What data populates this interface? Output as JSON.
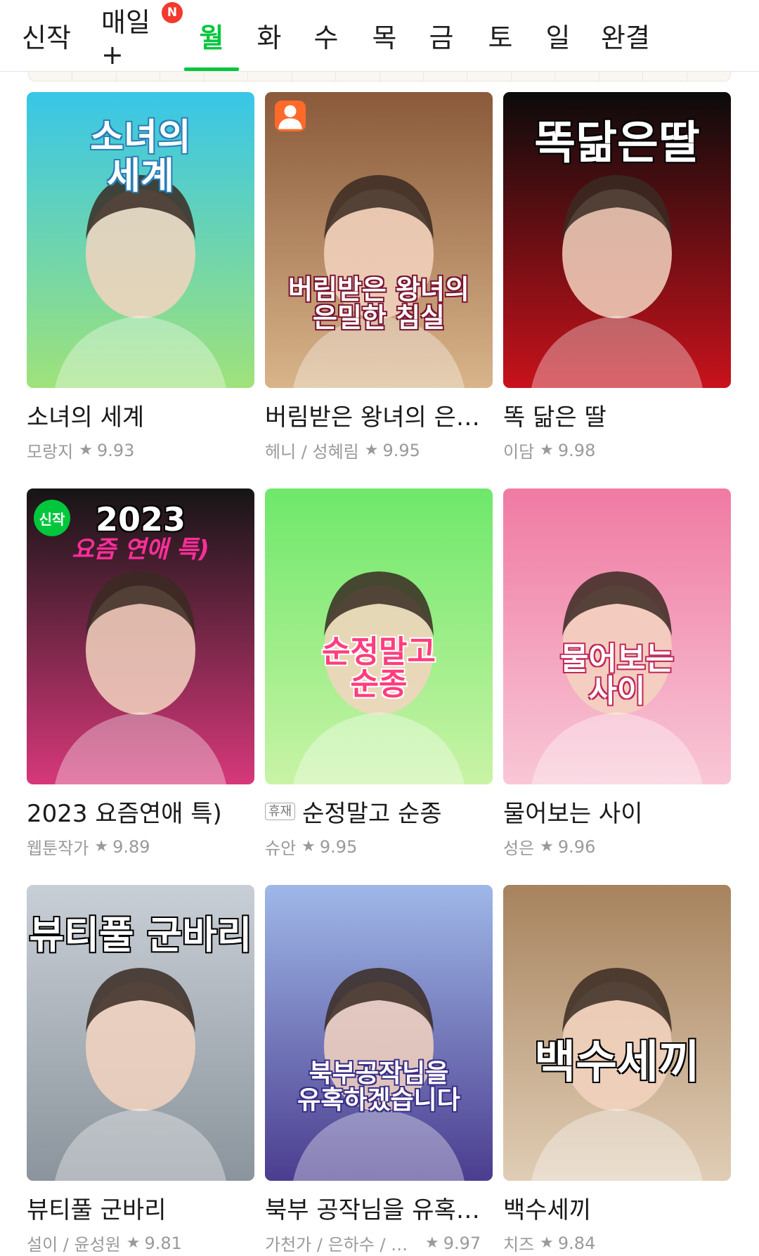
{
  "tabs": [
    {
      "label": "신작",
      "active": false
    },
    {
      "label": "매일+",
      "active": false,
      "badge": "N"
    },
    {
      "label": "월",
      "active": true
    },
    {
      "label": "화",
      "active": false
    },
    {
      "label": "수",
      "active": false
    },
    {
      "label": "목",
      "active": false
    },
    {
      "label": "금",
      "active": false
    },
    {
      "label": "토",
      "active": false
    },
    {
      "label": "일",
      "active": false
    },
    {
      "label": "완결",
      "active": false
    }
  ],
  "colors": {
    "accent": "#00c73c",
    "badge": "#f2392f"
  },
  "star_icon": "★",
  "cards": [
    {
      "title": "소녀의 세계",
      "author": "모랑지",
      "rating": "9.93",
      "cover_text": "소녀의\n세계",
      "cover_colors": [
        "#38c6e8",
        "#9fe27a"
      ]
    },
    {
      "title": "버림받은 왕녀의 은밀한 침실",
      "author": "헤니 / 성혜림",
      "rating": "9.95",
      "cover_text": "버림받은 왕녀의\n은밀한 침실",
      "cover_colors": [
        "#8a5a3a",
        "#d9b48a"
      ]
    },
    {
      "title": "똑 닮은 딸",
      "author": "이담",
      "rating": "9.98",
      "cover_text": "똑닮은딸",
      "cover_colors": [
        "#0b0b0b",
        "#c8121c"
      ]
    },
    {
      "title": "2023 요즘연애 특)",
      "author": "웹툰작가",
      "rating": "9.89",
      "cover_text": "2023",
      "cover_subtext": "요즘 연애 특)",
      "new_label": "신작",
      "cover_colors": [
        "#151515",
        "#d7387a"
      ]
    },
    {
      "title": "순정말고 순종",
      "author": "슈안",
      "rating": "9.95",
      "rest_tag": "휴재",
      "cover_text": "순정말고\n순종",
      "cover_colors": [
        "#6ee86a",
        "#c9f3a6"
      ]
    },
    {
      "title": "물어보는 사이",
      "author": "성은",
      "rating": "9.96",
      "cover_text": "물어보는\n사이",
      "cover_colors": [
        "#f07aa3",
        "#f8c7d6"
      ]
    },
    {
      "title": "뷰티풀 군바리",
      "author": "설이 / 윤성원",
      "rating": "9.81",
      "cover_text": "뷰티풀 군바리",
      "cover_colors": [
        "#c9cfd6",
        "#8b949c"
      ]
    },
    {
      "title": "북부 공작님을 유혹하겠습니다",
      "author": "가천가 / 은하수 / 주…",
      "rating": "9.97",
      "cover_text": "북부공작님을\n유혹하겠습니다",
      "cover_colors": [
        "#9fb8e8",
        "#4b3d8f"
      ]
    },
    {
      "title": "백수세끼",
      "author": "치즈",
      "rating": "9.84",
      "cover_text": "백수세끼",
      "cover_colors": [
        "#a7835e",
        "#e0cdb5"
      ]
    }
  ]
}
